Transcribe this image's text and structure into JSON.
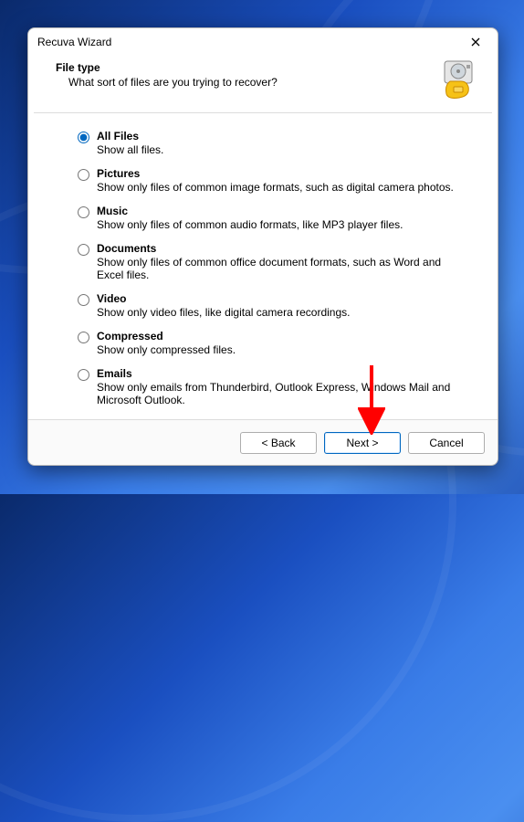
{
  "window": {
    "title": "Recuva Wizard"
  },
  "header": {
    "title": "File type",
    "subtitle": "What sort of files are you trying to recover?"
  },
  "options": [
    {
      "label": "All Files",
      "desc": "Show all files.",
      "selected": true
    },
    {
      "label": "Pictures",
      "desc": "Show only files of common image formats, such as digital camera photos.",
      "selected": false
    },
    {
      "label": "Music",
      "desc": "Show only files of common audio formats, like MP3 player files.",
      "selected": false
    },
    {
      "label": "Documents",
      "desc": "Show only files of common office document formats, such as Word and Excel files.",
      "selected": false
    },
    {
      "label": "Video",
      "desc": "Show only video files, like digital camera recordings.",
      "selected": false
    },
    {
      "label": "Compressed",
      "desc": "Show only compressed files.",
      "selected": false
    },
    {
      "label": "Emails",
      "desc": "Show only emails from Thunderbird, Outlook Express, Windows Mail and Microsoft Outlook.",
      "selected": false
    }
  ],
  "buttons": {
    "back": "< Back",
    "next": "Next >",
    "cancel": "Cancel"
  },
  "annotation": {
    "arrow_color": "#ff0000"
  }
}
